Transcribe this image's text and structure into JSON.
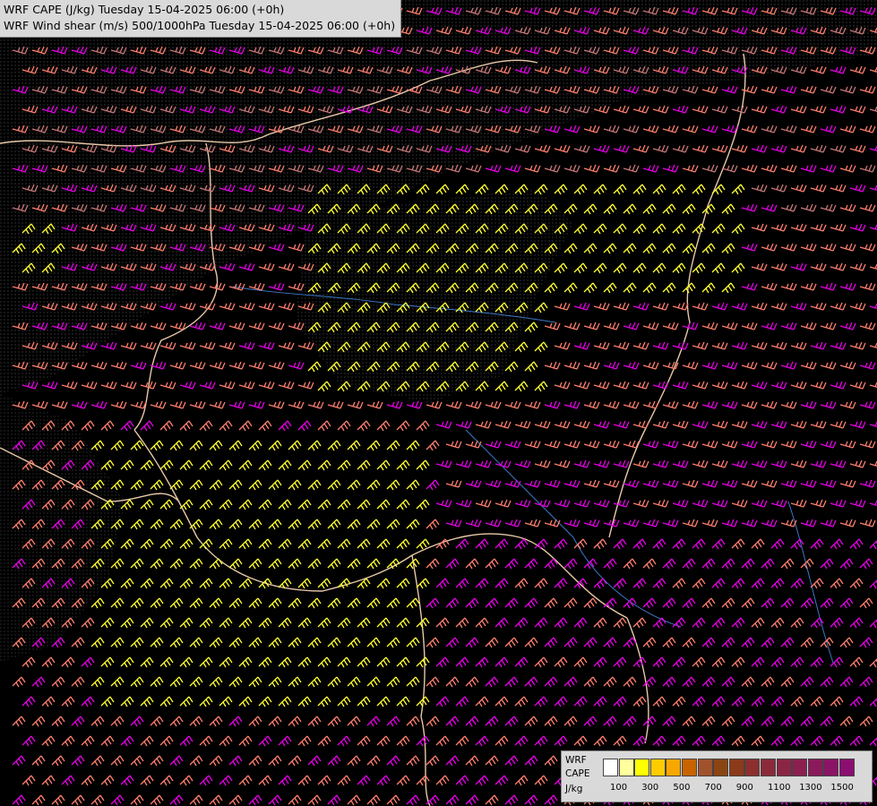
{
  "title": {
    "line1": "WRF CAPE (J/kg) Tuesday 15-04-2025 06:00 (+0h)",
    "line2": "WRF Wind shear (m/s) 500/1000hPa Tuesday 15-04-2025 06:00 (+0h)"
  },
  "legend": {
    "label_model": "WRF",
    "label_field": "CAPE",
    "label_unit": "J/kg",
    "colors": [
      "#ffffff",
      "#ffff9e",
      "#ffff00",
      "#ffcc00",
      "#f7a700",
      "#c86400",
      "#a0522d",
      "#8b4513",
      "#8b3a1a",
      "#8b2f2f",
      "#8b2a3a",
      "#8b2546",
      "#8b2050",
      "#8b1a5c",
      "#8b1466",
      "#8b0f70"
    ],
    "ticks": [
      "100",
      "300",
      "500",
      "700",
      "900",
      "1100",
      "1300",
      "1500"
    ]
  },
  "wind_colors": {
    "yellow": "#ffff33",
    "salmon": "#ff7f6e",
    "magenta": "#e600e6",
    "rose": "#c87878"
  }
}
